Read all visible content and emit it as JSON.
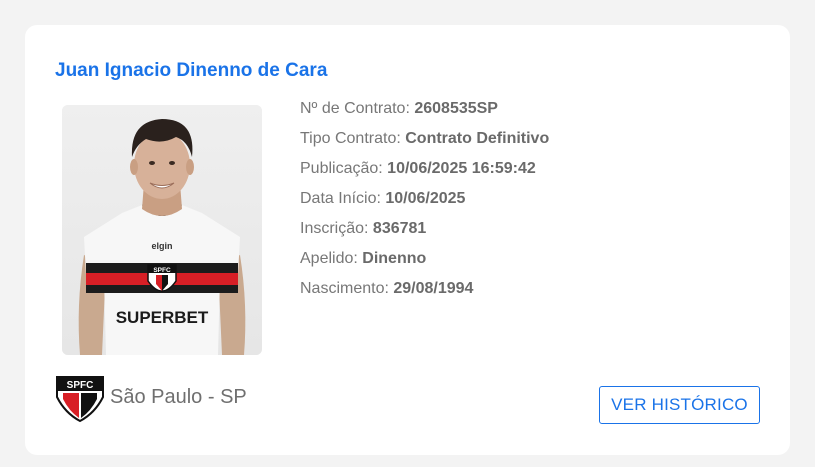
{
  "player": {
    "name": "Juan Ignacio Dinenno de Cara",
    "photo": {
      "shirt_sponsor": "SUPERBET",
      "shirt_crest": "SPFC",
      "shirt_brand": "elgin"
    }
  },
  "details": [
    {
      "label": "Nº de Contrato: ",
      "value": "2608535SP"
    },
    {
      "label": "Tipo Contrato: ",
      "value": "Contrato Definitivo"
    },
    {
      "label": "Publicação: ",
      "value": "10/06/2025 16:59:42"
    },
    {
      "label": "Data Início: ",
      "value": "10/06/2025"
    },
    {
      "label": "Inscrição: ",
      "value": "836781"
    },
    {
      "label": "Apelido: ",
      "value": "Dinenno"
    },
    {
      "label": "Nascimento: ",
      "value": "29/08/1994"
    }
  ],
  "club": {
    "crest_icon": "spfc-crest-icon",
    "crest_text": "SPFC",
    "name": "São Paulo - SP"
  },
  "actions": {
    "history_label": "VER HISTÓRICO"
  },
  "colors": {
    "accent": "#1a73e8",
    "text_muted": "#777777",
    "card_background": "#ffffff",
    "page_background": "#f3f3f3"
  }
}
